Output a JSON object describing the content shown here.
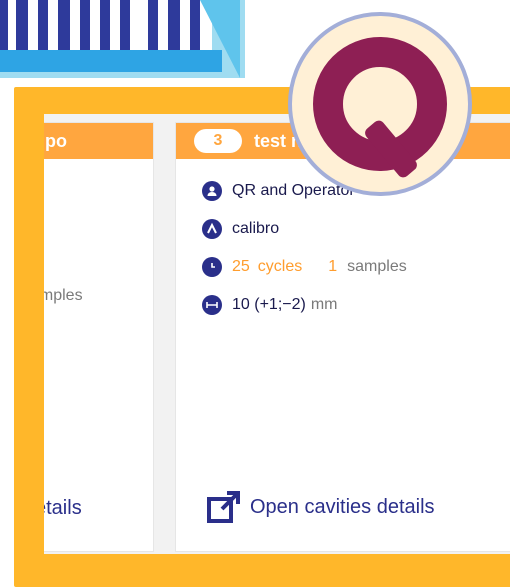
{
  "left_card": {
    "header_fragment": "po",
    "samples_fragment": "amples",
    "details_fragment": "etails"
  },
  "right_card": {
    "badge": "3",
    "header_fragment": "test n",
    "operator": "QR  and  Operator",
    "tool": "calibro",
    "cycles_value": "25",
    "cycles_label": "cycles",
    "samples_value": "1",
    "samples_label": "samples",
    "tolerance_value": "10 (+1;−2)",
    "tolerance_unit": "mm",
    "open_details_label": "Open cavities details"
  },
  "icons": {
    "operator": "user-icon",
    "tool": "caliper-icon",
    "cycles": "clock-icon",
    "tolerance": "dimension-icon",
    "open": "external-link-icon",
    "logo": "q-logo-icon"
  },
  "colors": {
    "frame": "#ffb72a",
    "header": "#ffa63f",
    "navy": "#2a2f8a",
    "logo": "#8e1f54"
  }
}
